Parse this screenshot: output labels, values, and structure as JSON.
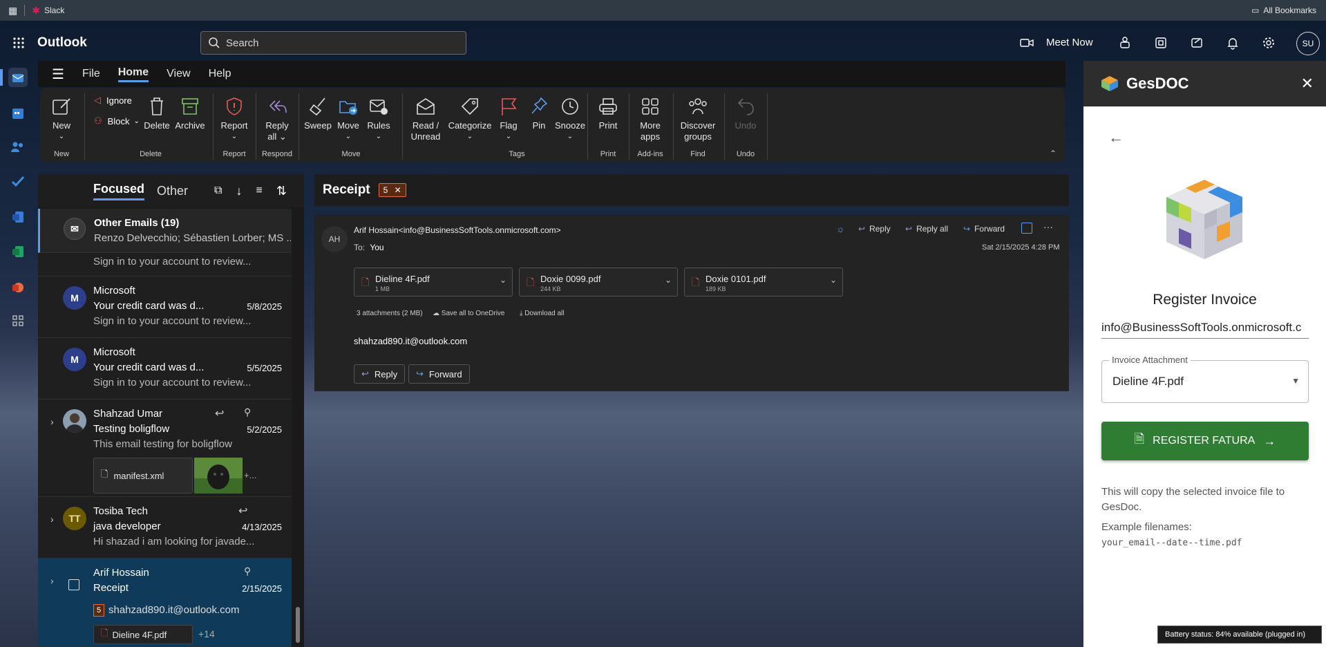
{
  "chrome": {
    "tab_title": "Slack",
    "bookmarks": "All Bookmarks"
  },
  "app": {
    "name": "Outlook",
    "search_placeholder": "Search",
    "meet_now": "Meet Now",
    "avatar_initials": "SU"
  },
  "menu": [
    "File",
    "Home",
    "View",
    "Help"
  ],
  "ribbon": {
    "new": "New",
    "ignore": "Ignore",
    "block": "Block",
    "delete": "Delete",
    "archive": "Archive",
    "report": "Report",
    "reply_all": "Reply",
    "reply_all2": "all",
    "sweep": "Sweep",
    "move": "Move",
    "rules": "Rules",
    "read_unread": "Read /",
    "read_unread2": "Unread",
    "categorize": "Categorize",
    "flag": "Flag",
    "pin": "Pin",
    "snooze": "Snooze",
    "print": "Print",
    "more_apps": "More",
    "more_apps2": "apps",
    "discover_groups": "Discover",
    "discover_groups2": "groups",
    "undo": "Undo",
    "groups": {
      "new": "New",
      "delete": "Delete",
      "report": "Report",
      "respond": "Respond",
      "move": "Move",
      "tags": "Tags",
      "print": "Print",
      "addins": "Add-ins",
      "find": "Find",
      "undo": "Undo"
    }
  },
  "list": {
    "tabs": {
      "focused": "Focused",
      "other": "Other"
    },
    "group": {
      "title": "Other Emails (19)",
      "senders": "Renzo Delvecchio; Sébastien Lorber; MS ..."
    },
    "partial_preview": "Sign in to your account to review...",
    "items": [
      {
        "sender": "Microsoft",
        "subject": "Your credit card was d...",
        "date": "5/8/2025",
        "preview": "Sign in to your account to review...",
        "initials": "M"
      },
      {
        "sender": "Microsoft",
        "subject": "Your credit card was d...",
        "date": "5/5/2025",
        "preview": "Sign in to your account to review...",
        "initials": "M"
      },
      {
        "sender": "Shahzad Umar",
        "subject": "Testing boligflow",
        "date": "5/2/2025",
        "preview": "This email testing for boligflow",
        "attachment": "manifest.xml",
        "more": "+..."
      },
      {
        "sender": "Tosiba Tech",
        "subject": "java developer",
        "date": "4/13/2025",
        "preview": "Hi shazad i am looking for javade...",
        "initials": "TT"
      },
      {
        "sender": "Arif Hossain",
        "subject": "Receipt",
        "date": "2/15/2025",
        "count": "5",
        "preview": "shahzad890.it@outlook.com",
        "attachment": "Dieline 4F.pdf",
        "more": "+14"
      }
    ]
  },
  "reading": {
    "subject": "Receipt",
    "count": "5",
    "from_initials": "AH",
    "from": "Arif Hossain<info@BusinessSoftTools.onmicrosoft.com>",
    "to_label": "To:",
    "to": "You",
    "date": "Sat 2/15/2025 4:28 PM",
    "actions": {
      "reply": "Reply",
      "reply_all": "Reply all",
      "forward": "Forward"
    },
    "attachments": [
      {
        "name": "Dieline 4F.pdf",
        "size": "1 MB"
      },
      {
        "name": "Doxie 0099.pdf",
        "size": "244 KB"
      },
      {
        "name": "Doxie 0101.pdf",
        "size": "189 KB"
      }
    ],
    "att_summary": "3 attachments (2 MB)",
    "save_onedrive": "Save all to OneDrive",
    "download_all": "Download all",
    "body": "shahzad890.it@outlook.com",
    "reply_btn": "Reply",
    "forward_btn": "Forward"
  },
  "gesdoc": {
    "title": "GesDOC",
    "heading": "Register Invoice",
    "email": "info@BusinessSoftTools.onmicrosoft.c",
    "attachment_label": "Invoice Attachment",
    "attachment_value": "Dieline 4F.pdf",
    "button": "REGISTER FATURA",
    "info": "This will copy the selected invoice file to GesDoc.",
    "example_label": "Example filenames:",
    "example": "your_email--date--time.pdf"
  },
  "status": {
    "battery": "Battery status: 84% available (plugged in)"
  },
  "colors": {
    "accent": "#5c9ded",
    "gesdoc_button": "#2e7d32",
    "selected_row": "#0f3a5a",
    "badge": "#c4501c"
  }
}
